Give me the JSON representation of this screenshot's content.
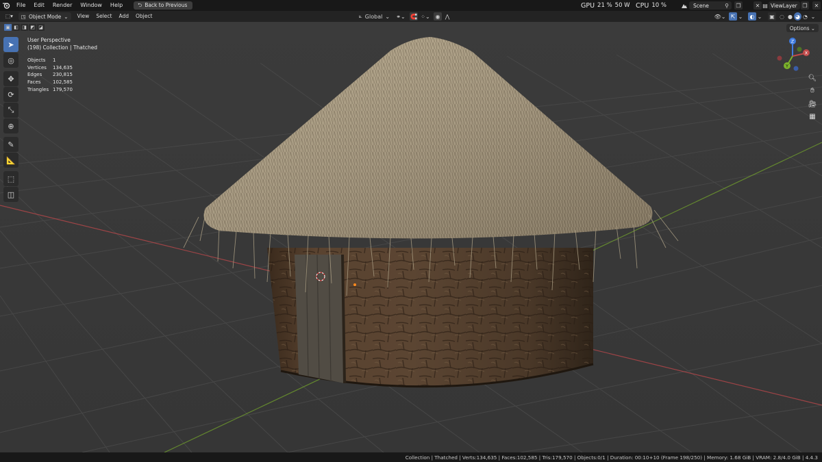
{
  "menu": {
    "items": [
      "File",
      "Edit",
      "Render",
      "Window",
      "Help"
    ],
    "back_button": "Back to Previous"
  },
  "performance": {
    "gpu_label": "GPU",
    "gpu_value": "21 %",
    "gpu_power": "50 W",
    "cpu_label": "CPU",
    "cpu_value": "10 %"
  },
  "scene": {
    "name": "Scene"
  },
  "view_layer": {
    "name": "ViewLayer"
  },
  "viewport_header": {
    "mode": "Object Mode",
    "menus": [
      "View",
      "Select",
      "Add",
      "Object"
    ],
    "transform_orientation": "Global",
    "options_label": "Options"
  },
  "overlay": {
    "view_name": "User Perspective",
    "collection_line": "(198) Collection | Thatched",
    "stats": [
      {
        "label": "Objects",
        "value": "1"
      },
      {
        "label": "Vertices",
        "value": "134,635"
      },
      {
        "label": "Edges",
        "value": "230,815"
      },
      {
        "label": "Faces",
        "value": "102,585"
      },
      {
        "label": "Triangles",
        "value": "179,570"
      }
    ]
  },
  "gizmo": {
    "x": "X",
    "y": "Y",
    "z": "Z"
  },
  "statusbar": {
    "text": "Collection | Thatched | Verts:134,635 | Faces:102,585 | Tris:179,570 | Objects:0/1 | Duration: 00:10+10 (Frame 198/250) | Memory: 1.68 GiB | VRAM: 2.8/4.0 GiB | 4.4.3"
  },
  "colors": {
    "accent": "#4772b3",
    "x_axis": "#c24a4a",
    "y_axis": "#7bb22b",
    "z_axis": "#3f7be0"
  }
}
